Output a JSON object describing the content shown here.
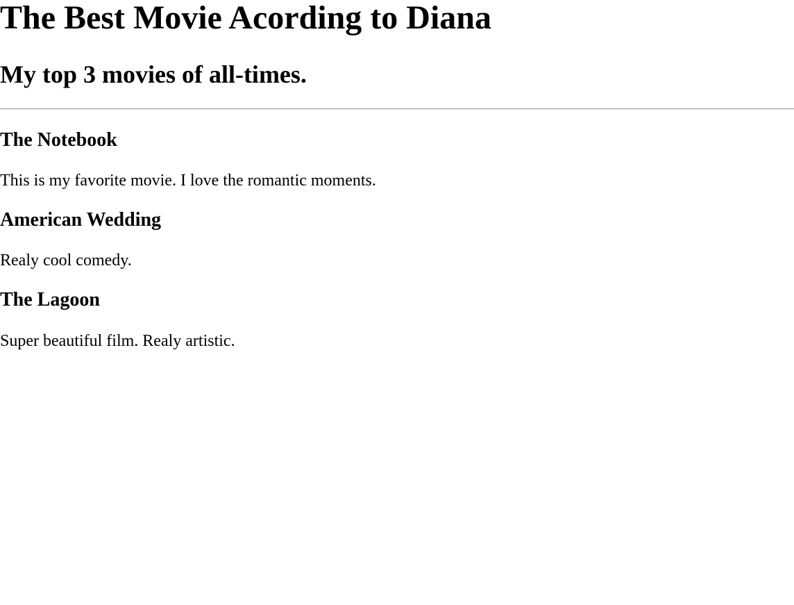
{
  "page": {
    "title": "The Best Movie Acording to Diana",
    "subtitle": "My top 3 movies of all-times."
  },
  "movies": [
    {
      "title": "The Notebook",
      "description": "This is my favorite movie. I love the romantic moments."
    },
    {
      "title": "American Wedding",
      "description": "Realy cool comedy."
    },
    {
      "title": "The Lagoon",
      "description": "Super beautiful film. Realy artistic."
    }
  ],
  "colors": {
    "background": "#ffffff",
    "text": "#000000",
    "divider": "#9a9a9a"
  }
}
